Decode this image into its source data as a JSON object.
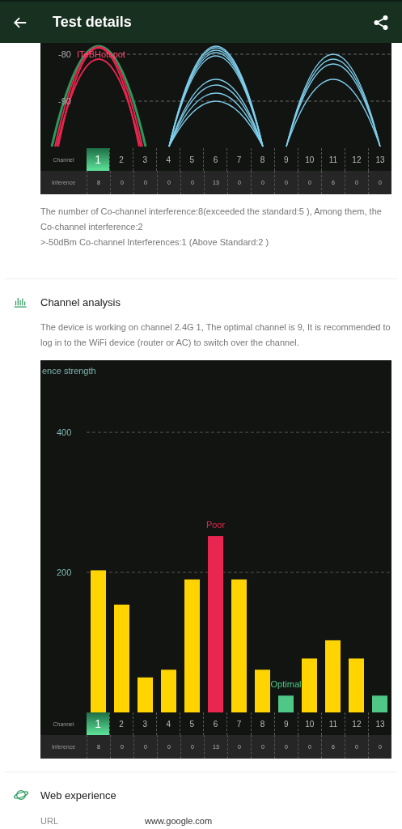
{
  "app_bar": {
    "title": "Test details"
  },
  "signal_chart": {
    "ticks": [
      "-80",
      "-90"
    ],
    "network_label": "ITeBHotspot",
    "channel_row": {
      "label": "Channel",
      "channels": [
        {
          "label": "1",
          "selected": true
        },
        {
          "label": "2",
          "selected": false
        },
        {
          "label": "3",
          "selected": false
        },
        {
          "label": "4",
          "selected": false
        },
        {
          "label": "5",
          "selected": false
        },
        {
          "label": "6",
          "selected": false
        },
        {
          "label": "7",
          "selected": false
        },
        {
          "label": "8",
          "selected": false
        },
        {
          "label": "9",
          "selected": false
        },
        {
          "label": "10",
          "selected": false
        },
        {
          "label": "11",
          "selected": false
        },
        {
          "label": "12",
          "selected": false
        },
        {
          "label": "13",
          "selected": false
        }
      ]
    },
    "inference_row": {
      "label": "Inference",
      "values": [
        "8",
        "0",
        "0",
        "0",
        "0",
        "13",
        "0",
        "0",
        "0",
        "0",
        "6",
        "0",
        "0"
      ]
    }
  },
  "interference_text": [
    "The number of Co-channel interference:8(exceeded the standard:5 ), Among them, the Co-channel interference:2",
    ">-50dBm Co-channel Interferences:1 (Above Standard:2 )"
  ],
  "channel_analysis": {
    "title": "Channel analysis",
    "description": "The device is working on channel 2.4G 1, The optimal channel is 9, It is recommended to log in to the WiFi device (router or AC) to switch over the channel.",
    "chart_data": {
      "type": "bar",
      "ylabel": "ence strength",
      "series": [
        {
          "color": "#ffd400",
          "colors": [
            null,
            null,
            null,
            null,
            null,
            "#e8264f",
            null,
            null,
            "#4fc887",
            null,
            null,
            null,
            "#4fc887"
          ],
          "values": [
            203,
            154,
            50,
            61,
            190,
            252,
            190,
            61,
            24,
            77,
            103,
            77,
            24
          ]
        }
      ],
      "ylim": [
        0,
        503
      ],
      "yticks": [
        200,
        400
      ],
      "annotations": [
        "Poor",
        "Optimal"
      ]
    },
    "channel_row": {
      "label": "Channel",
      "channels": [
        {
          "label": "1",
          "selected": true
        },
        {
          "label": "2",
          "selected": false
        },
        {
          "label": "3",
          "selected": false
        },
        {
          "label": "4",
          "selected": false
        },
        {
          "label": "5",
          "selected": false
        },
        {
          "label": "6",
          "selected": false
        },
        {
          "label": "7",
          "selected": false
        },
        {
          "label": "8",
          "selected": false
        },
        {
          "label": "9",
          "selected": false
        },
        {
          "label": "10",
          "selected": false
        },
        {
          "label": "11",
          "selected": false
        },
        {
          "label": "12",
          "selected": false
        },
        {
          "label": "13",
          "selected": false
        }
      ]
    },
    "inference_row": {
      "label": "Inference",
      "values": [
        "8",
        "0",
        "0",
        "0",
        "0",
        "13",
        "0",
        "0",
        "0",
        "0",
        "6",
        "0",
        "0"
      ]
    }
  },
  "web_experience": {
    "title": "Web experience",
    "rows": [
      {
        "label": "URL",
        "value": "www.google.com"
      }
    ]
  }
}
